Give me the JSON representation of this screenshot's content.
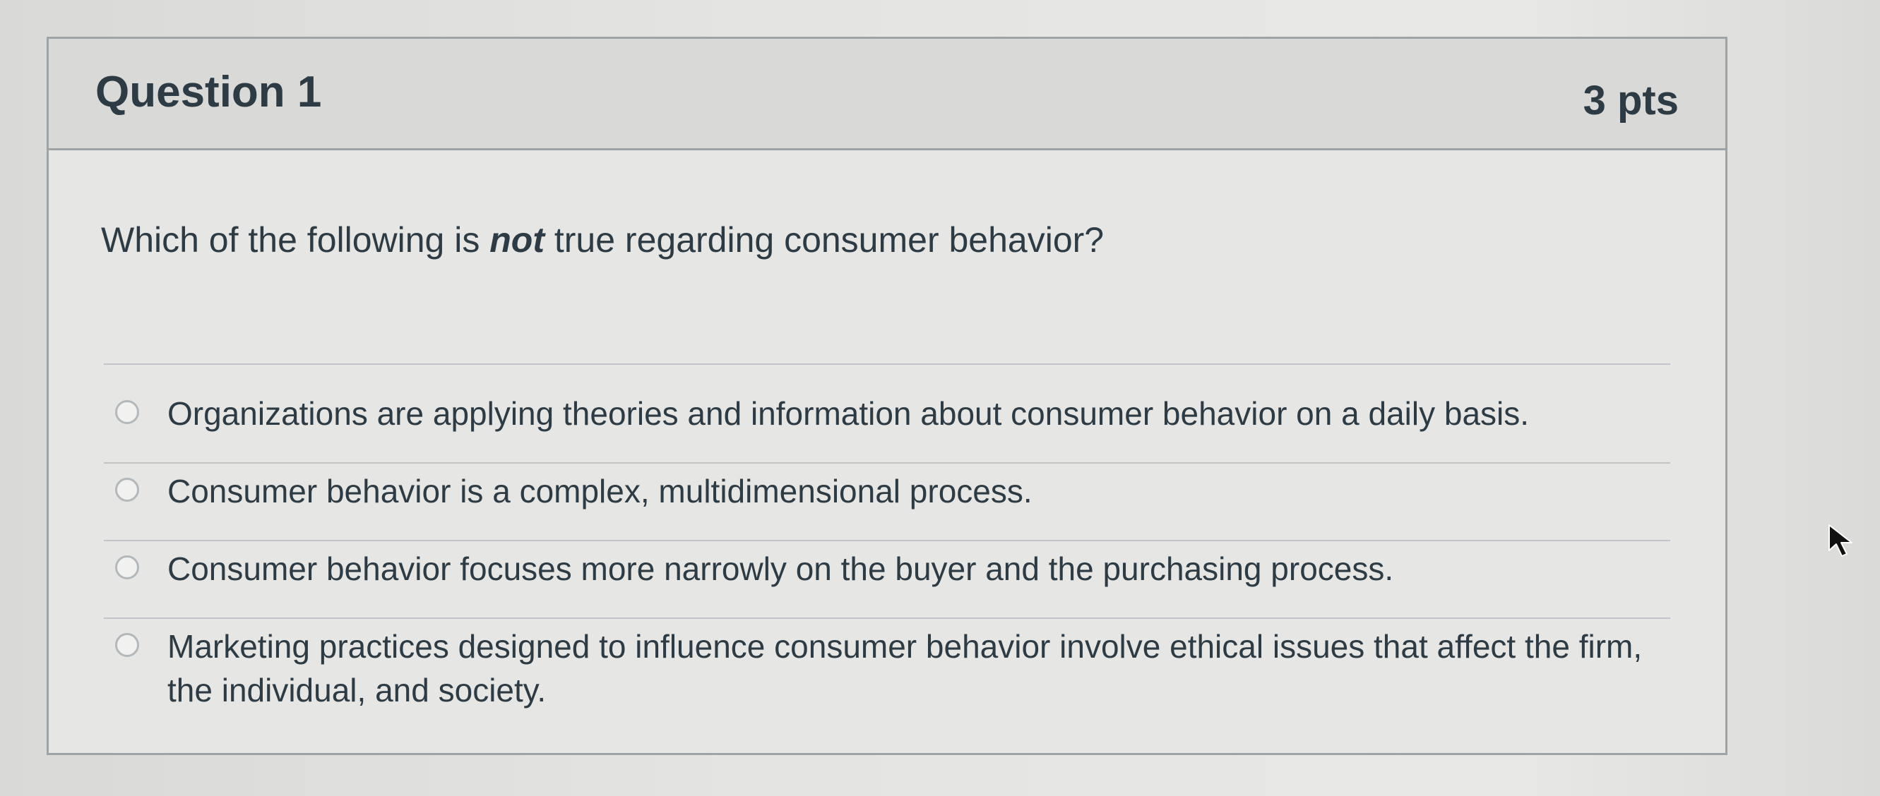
{
  "question": {
    "title": "Question 1",
    "points": "3 pts",
    "prompt_before": "Which of the following is ",
    "prompt_emphasis": "not",
    "prompt_after": " true regarding consumer behavior?"
  },
  "answers": [
    {
      "text": "Organizations are applying theories and information about consumer behavior on a daily basis.",
      "selected": false
    },
    {
      "text": "Consumer behavior is a complex, multidimensional process.",
      "selected": false
    },
    {
      "text": "Consumer behavior focuses more narrowly on the buyer and the purchasing process.",
      "selected": false
    },
    {
      "text": "Marketing practices designed to influence consumer behavior involve ethical issues that affect the firm, the individual, and society.",
      "selected": false
    }
  ],
  "icons": {
    "cursor": "mouse-pointer-icon",
    "radio": "radio-button-icon"
  },
  "colors": {
    "text": "#2d3b45",
    "border": "#9ea3a6",
    "header_bg": "#d9d9d7"
  }
}
